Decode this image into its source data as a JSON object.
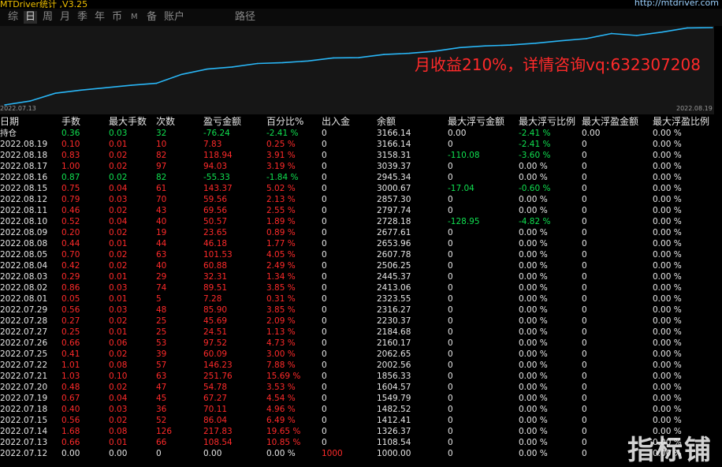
{
  "title": "MTDriver统计 ,V3.25",
  "url": "http://mtdriver.com",
  "tabs": [
    {
      "label": "综",
      "active": false
    },
    {
      "label": "日",
      "active": true
    },
    {
      "label": "周",
      "active": false
    },
    {
      "label": "月",
      "active": false
    },
    {
      "label": "季",
      "active": false
    },
    {
      "label": "年",
      "active": false
    },
    {
      "label": "币",
      "active": false
    },
    {
      "label": "M",
      "active": false
    },
    {
      "label": "备",
      "active": false
    },
    {
      "label": "账户",
      "active": false
    },
    {
      "label": "路径",
      "active": false
    }
  ],
  "promo_text": "月收益210%，详情咨询vq:632307208",
  "watermark": "指标铺",
  "chart_data": {
    "type": "line",
    "x": [
      "2022.07.12",
      "2022.07.13",
      "2022.07.14",
      "2022.07.15",
      "2022.07.18",
      "2022.07.19",
      "2022.07.20",
      "2022.07.21",
      "2022.07.22",
      "2022.07.25",
      "2022.07.26",
      "2022.07.27",
      "2022.07.28",
      "2022.07.29",
      "2022.08.01",
      "2022.08.02",
      "2022.08.03",
      "2022.08.04",
      "2022.08.05",
      "2022.08.08",
      "2022.08.09",
      "2022.08.10",
      "2022.08.11",
      "2022.08.12",
      "2022.08.15",
      "2022.08.16",
      "2022.08.17",
      "2022.08.18",
      "2022.08.19"
    ],
    "values": [
      1000.0,
      1108.54,
      1326.37,
      1412.41,
      1482.52,
      1549.79,
      1604.57,
      1856.33,
      2002.56,
      2062.65,
      2160.17,
      2184.68,
      2230.37,
      2316.27,
      2323.55,
      2413.06,
      2445.37,
      2506.25,
      2607.78,
      2653.96,
      2677.61,
      2728.18,
      2797.74,
      2857.3,
      3000.67,
      2945.34,
      3039.37,
      3158.31,
      3166.14
    ],
    "x_tick_labels": [
      "2022.07.13",
      "2022.08.19"
    ],
    "color": "#29b6f6"
  },
  "table": {
    "headers": [
      "日期",
      "手数",
      "最大手数",
      "次数",
      "盈亏金额",
      "百分比%",
      "出入金",
      "余额",
      "最大浮亏金额",
      "最大浮亏比例",
      "最大浮盈金额",
      "最大浮盈比例"
    ],
    "rows": [
      {
        "c": [
          "持仓",
          "0.36",
          "0.03",
          "32",
          "-76.24",
          "-2.41 %",
          "0",
          "3166.14",
          "0.00",
          "-2.41 %",
          "0.00",
          "0.00 %"
        ],
        "t": "neg"
      },
      {
        "c": [
          "2022.08.19",
          "0.10",
          "0.01",
          "10",
          "7.83",
          "0.25 %",
          "0",
          "3166.14",
          "0",
          "-2.41 %",
          "0",
          "0.00 %"
        ],
        "t": "pos"
      },
      {
        "c": [
          "2022.08.18",
          "0.83",
          "0.02",
          "82",
          "118.94",
          "3.91 %",
          "0",
          "3158.31",
          "-110.08",
          "-3.60 %",
          "0",
          "0.00 %"
        ],
        "t": "pos"
      },
      {
        "c": [
          "2022.08.17",
          "1.00",
          "0.02",
          "97",
          "94.03",
          "3.19 %",
          "0",
          "3039.37",
          "0",
          "0.00 %",
          "0",
          "0.00 %"
        ],
        "t": "pos"
      },
      {
        "c": [
          "2022.08.16",
          "0.87",
          "0.02",
          "82",
          "-55.33",
          "-1.84 %",
          "0",
          "2945.34",
          "0",
          "0.00 %",
          "0",
          "0.00 %"
        ],
        "t": "neg"
      },
      {
        "c": [
          "2022.08.15",
          "0.75",
          "0.04",
          "61",
          "143.37",
          "5.02 %",
          "0",
          "3000.67",
          "-17.04",
          "-0.60 %",
          "0",
          "0.00 %"
        ],
        "t": "pos"
      },
      {
        "c": [
          "2022.08.12",
          "0.79",
          "0.03",
          "70",
          "59.56",
          "2.13 %",
          "0",
          "2857.30",
          "0",
          "0.00 %",
          "0",
          "0.00 %"
        ],
        "t": "pos"
      },
      {
        "c": [
          "2022.08.11",
          "0.46",
          "0.02",
          "43",
          "69.56",
          "2.55 %",
          "0",
          "2797.74",
          "0",
          "0.00 %",
          "0",
          "0.00 %"
        ],
        "t": "pos"
      },
      {
        "c": [
          "2022.08.10",
          "0.52",
          "0.04",
          "40",
          "50.57",
          "1.89 %",
          "0",
          "2728.18",
          "-128.95",
          "-4.82 %",
          "0",
          "0.00 %"
        ],
        "t": "pos"
      },
      {
        "c": [
          "2022.08.09",
          "0.20",
          "0.02",
          "19",
          "23.65",
          "0.89 %",
          "0",
          "2677.61",
          "0",
          "0.00 %",
          "0",
          "0.00 %"
        ],
        "t": "pos"
      },
      {
        "c": [
          "2022.08.08",
          "0.44",
          "0.01",
          "44",
          "46.18",
          "1.77 %",
          "0",
          "2653.96",
          "0",
          "0.00 %",
          "0",
          "0.00 %"
        ],
        "t": "pos"
      },
      {
        "c": [
          "2022.08.05",
          "0.70",
          "0.02",
          "63",
          "101.53",
          "4.05 %",
          "0",
          "2607.78",
          "0",
          "0.00 %",
          "0",
          "0.00 %"
        ],
        "t": "pos"
      },
      {
        "c": [
          "2022.08.04",
          "0.42",
          "0.02",
          "40",
          "60.88",
          "2.49 %",
          "0",
          "2506.25",
          "0",
          "0.00 %",
          "0",
          "0.00 %"
        ],
        "t": "pos"
      },
      {
        "c": [
          "2022.08.03",
          "0.29",
          "0.01",
          "29",
          "32.31",
          "1.34 %",
          "0",
          "2445.37",
          "0",
          "0.00 %",
          "0",
          "0.00 %"
        ],
        "t": "pos"
      },
      {
        "c": [
          "2022.08.02",
          "0.86",
          "0.03",
          "74",
          "89.51",
          "3.85 %",
          "0",
          "2413.06",
          "0",
          "0.00 %",
          "0",
          "0.00 %"
        ],
        "t": "pos"
      },
      {
        "c": [
          "2022.08.01",
          "0.05",
          "0.01",
          "5",
          "7.28",
          "0.31 %",
          "0",
          "2323.55",
          "0",
          "0.00 %",
          "0",
          "0.00 %"
        ],
        "t": "pos"
      },
      {
        "c": [
          "2022.07.29",
          "0.56",
          "0.03",
          "48",
          "85.90",
          "3.85 %",
          "0",
          "2316.27",
          "0",
          "0.00 %",
          "0",
          "0.00 %"
        ],
        "t": "pos"
      },
      {
        "c": [
          "2022.07.28",
          "0.27",
          "0.02",
          "25",
          "45.69",
          "2.09 %",
          "0",
          "2230.37",
          "0",
          "0.00 %",
          "0",
          "0.00 %"
        ],
        "t": "pos"
      },
      {
        "c": [
          "2022.07.27",
          "0.25",
          "0.01",
          "25",
          "24.51",
          "1.13 %",
          "0",
          "2184.68",
          "0",
          "0.00 %",
          "0",
          "0.00 %"
        ],
        "t": "pos"
      },
      {
        "c": [
          "2022.07.26",
          "0.66",
          "0.06",
          "53",
          "97.52",
          "4.73 %",
          "0",
          "2160.17",
          "0",
          "0.00 %",
          "0",
          "0.00 %"
        ],
        "t": "pos"
      },
      {
        "c": [
          "2022.07.25",
          "0.41",
          "0.02",
          "39",
          "60.09",
          "3.00 %",
          "0",
          "2062.65",
          "0",
          "0.00 %",
          "0",
          "0.00 %"
        ],
        "t": "pos"
      },
      {
        "c": [
          "2022.07.22",
          "1.01",
          "0.08",
          "57",
          "146.23",
          "7.88 %",
          "0",
          "2002.56",
          "0",
          "0.00 %",
          "0",
          "0.00 %"
        ],
        "t": "pos"
      },
      {
        "c": [
          "2022.07.21",
          "1.03",
          "0.10",
          "63",
          "251.76",
          "15.69 %",
          "0",
          "1856.33",
          "0",
          "0.00 %",
          "0",
          "0.00 %"
        ],
        "t": "pos"
      },
      {
        "c": [
          "2022.07.20",
          "0.48",
          "0.02",
          "47",
          "54.78",
          "3.53 %",
          "0",
          "1604.57",
          "0",
          "0.00 %",
          "0",
          "0.00 %"
        ],
        "t": "pos"
      },
      {
        "c": [
          "2022.07.19",
          "0.67",
          "0.04",
          "45",
          "67.27",
          "4.54 %",
          "0",
          "1549.79",
          "0",
          "0.00 %",
          "0",
          "0.00 %"
        ],
        "t": "pos"
      },
      {
        "c": [
          "2022.07.18",
          "0.40",
          "0.03",
          "36",
          "70.11",
          "4.96 %",
          "0",
          "1482.52",
          "0",
          "0.00 %",
          "0",
          "0.00 %"
        ],
        "t": "pos"
      },
      {
        "c": [
          "2022.07.15",
          "0.56",
          "0.02",
          "52",
          "86.04",
          "6.49 %",
          "0",
          "1412.41",
          "0",
          "0.00 %",
          "0",
          "0.00 %"
        ],
        "t": "pos"
      },
      {
        "c": [
          "2022.07.14",
          "1.68",
          "0.08",
          "126",
          "217.83",
          "19.65 %",
          "0",
          "1326.37",
          "0",
          "0.00 %",
          "0",
          "0.00 %"
        ],
        "t": "pos"
      },
      {
        "c": [
          "2022.07.13",
          "0.66",
          "0.01",
          "66",
          "108.54",
          "10.85 %",
          "0",
          "1108.54",
          "0",
          "0.00 %",
          "0",
          "0.00 %"
        ],
        "t": "pos"
      },
      {
        "c": [
          "2022.07.12",
          "0.00",
          "0.00",
          "0",
          "0.00",
          "0.00 %",
          "1000",
          "1000.00",
          "0",
          "0.00 %",
          "0",
          "0.00 %"
        ],
        "t": "neu"
      }
    ]
  }
}
